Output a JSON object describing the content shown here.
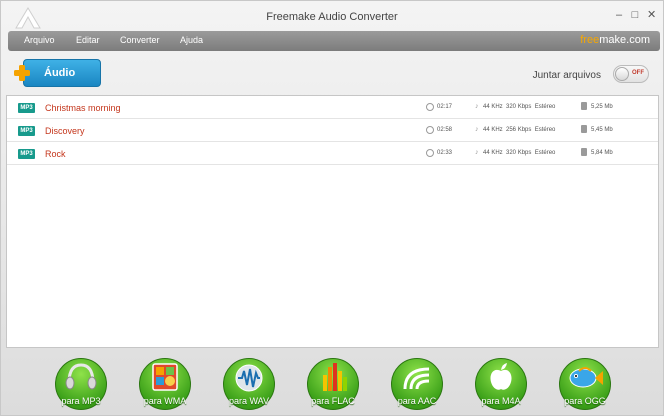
{
  "window": {
    "title": "Freemake Audio Converter",
    "controls": {
      "minimize": "–",
      "maximize": "□",
      "close": "✕"
    }
  },
  "menu": {
    "items": [
      "Arquivo",
      "Editar",
      "Converter",
      "Ajuda"
    ],
    "brand_free": "free",
    "brand_rest": "make.com"
  },
  "toolbar": {
    "add_audio_label": "Áudio",
    "join_label": "Juntar arquivos",
    "toggle_state": "OFF"
  },
  "tracks": [
    {
      "format": "MP3",
      "name": "Christmas morning",
      "duration": "02:17",
      "meta": "44 KHz  320 Kbps  Estéreo",
      "size": "5,25 Mb"
    },
    {
      "format": "MP3",
      "name": "Discovery",
      "duration": "02:58",
      "meta": "44 KHz  256 Kbps  Estéreo",
      "size": "5,45 Mb"
    },
    {
      "format": "MP3",
      "name": "Rock",
      "duration": "02:33",
      "meta": "44 KHz  320 Kbps  Estéreo",
      "size": "5,84 Mb"
    }
  ],
  "formats": [
    {
      "label": "para MP3",
      "icon": "headphones-icon"
    },
    {
      "label": "para WMA",
      "icon": "windows-media-icon"
    },
    {
      "label": "para WAV",
      "icon": "waveform-icon"
    },
    {
      "label": "para FLAC",
      "icon": "equalizer-icon"
    },
    {
      "label": "para AAC",
      "icon": "aac-waves-icon"
    },
    {
      "label": "para M4A",
      "icon": "apple-icon"
    },
    {
      "label": "para OGG",
      "icon": "fish-icon"
    }
  ],
  "colors": {
    "accent_blue": "#1a86c2",
    "track_text": "#c4351b",
    "badge": "#179a8c",
    "format_green": "#3da21a",
    "brand_orange": "#f7a800"
  }
}
